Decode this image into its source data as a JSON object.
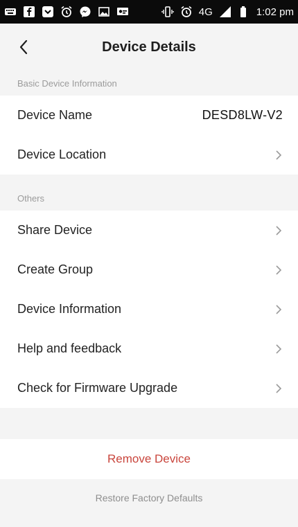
{
  "status_bar": {
    "time": "1:02 pm",
    "network": "4G",
    "left_icons": [
      "keyboard-icon",
      "facebook-icon",
      "download-icon",
      "alarm-icon",
      "messenger-icon",
      "gallery-icon",
      "vpn-icon"
    ],
    "right_icons": [
      "vibrate-icon",
      "alarm-icon",
      "signal-icon",
      "battery-icon"
    ]
  },
  "header": {
    "title": "Device Details",
    "back_icon": "chevron-left-icon"
  },
  "sections": {
    "basic": {
      "title": "Basic Device Information",
      "items": [
        {
          "label": "Device Name",
          "value": "DESD8LW-V2"
        },
        {
          "label": "Device Location"
        }
      ]
    },
    "others": {
      "title": "Others",
      "items": [
        {
          "label": "Share Device"
        },
        {
          "label": "Create Group"
        },
        {
          "label": "Device Information"
        },
        {
          "label": "Help and feedback"
        },
        {
          "label": "Check for Firmware Upgrade"
        }
      ]
    }
  },
  "actions": {
    "remove_label": "Remove Device",
    "restore_label": "Restore Factory Defaults"
  },
  "colors": {
    "background": "#f4f4f4",
    "section_background": "#ffffff",
    "danger": "#c9453c",
    "muted_text": "#9b9b9b"
  }
}
